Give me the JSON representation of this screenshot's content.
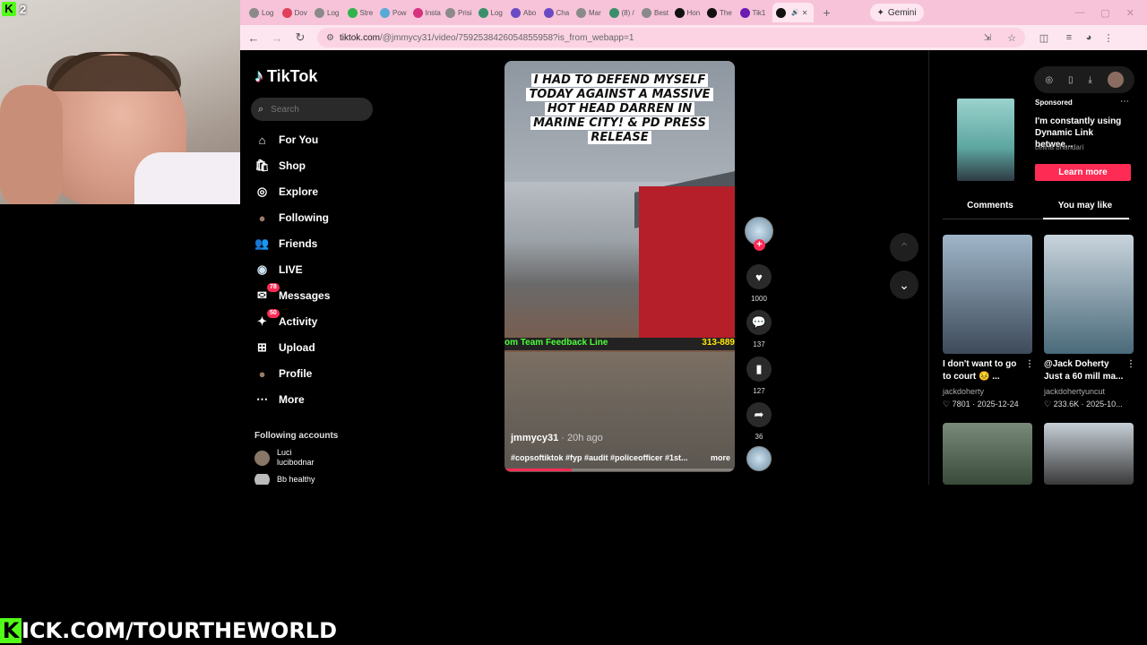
{
  "webcam": {
    "badge_count": "2"
  },
  "browser": {
    "tabs": [
      {
        "label": "Log",
        "color": "#8a8a8a"
      },
      {
        "label": "Dov",
        "color": "#e0405a"
      },
      {
        "label": "Log",
        "color": "#8a8a8a"
      },
      {
        "label": "Stre",
        "color": "#2fb34a"
      },
      {
        "label": "Pow",
        "color": "#59a9d8"
      },
      {
        "label": "Insta",
        "color": "#d6337c"
      },
      {
        "label": "Prisi",
        "color": "#8a8a8a"
      },
      {
        "label": "Log",
        "color": "#3a8f6a"
      },
      {
        "label": "Abo",
        "color": "#6a4bc4"
      },
      {
        "label": "Cha",
        "color": "#6a4bc4"
      },
      {
        "label": "Mar",
        "color": "#8a8a8a"
      },
      {
        "label": "(8) /",
        "color": "#3a8f6a"
      },
      {
        "label": "Best",
        "color": "#8a8a8a"
      },
      {
        "label": "Hon",
        "color": "#111111"
      },
      {
        "label": "The",
        "color": "#111111"
      },
      {
        "label": "Tik1",
        "color": "#6a1bb4"
      },
      {
        "label": "",
        "color": "#111111",
        "active": true
      }
    ],
    "new_tab": "+",
    "gemini": "Gemini",
    "window_controls": [
      "—",
      "▢",
      "✕"
    ],
    "url_domain": "tiktok.com",
    "url_path": "/@jmmycy31/video/7592538426054855958?is_from_webapp=1"
  },
  "tiktok": {
    "logo": "TikTok",
    "search_placeholder": "Search",
    "nav": [
      {
        "label": "For You",
        "icon": "home-icon",
        "glyph": "⌂"
      },
      {
        "label": "Shop",
        "icon": "shop-icon",
        "glyph": "🛍"
      },
      {
        "label": "Explore",
        "icon": "compass-icon",
        "glyph": "◎"
      },
      {
        "label": "Following",
        "icon": "following-avatar-icon",
        "glyph": "●"
      },
      {
        "label": "Friends",
        "icon": "friends-icon",
        "glyph": "👥"
      },
      {
        "label": "LIVE",
        "icon": "live-icon",
        "glyph": "◉"
      },
      {
        "label": "Messages",
        "icon": "messages-icon",
        "glyph": "✉",
        "badge": "78"
      },
      {
        "label": "Activity",
        "icon": "activity-icon",
        "glyph": "✦",
        "badge": "50"
      },
      {
        "label": "Upload",
        "icon": "upload-icon",
        "glyph": "⊞"
      },
      {
        "label": "Profile",
        "icon": "profile-icon",
        "glyph": "●"
      },
      {
        "label": "More",
        "icon": "more-icon",
        "glyph": "⋯"
      }
    ],
    "following_accounts_title": "Following accounts",
    "following_accounts": [
      {
        "name": "Luci",
        "handle": "lucibodnar"
      },
      {
        "name": "Bb healthy",
        "handle": ""
      }
    ],
    "video": {
      "caption_lines": [
        "I HAD TO DEFEND MYSELF",
        "TODAY AGAINST A MASSIVE",
        "HOT HEAD DARREN IN",
        "MARINE CITY! & PD PRESS",
        "RELEASE"
      ],
      "ticker_left": "om Team Feedback Line",
      "ticker_right": "313-889",
      "author": "jmmycy31",
      "time": "· 20h ago",
      "tags": "#copsoftiktok #fyp #audit #policeofficer #1st...",
      "more": "more",
      "progress": 0.29
    },
    "actions": {
      "likes": "1000",
      "comments": "137",
      "saves": "127",
      "shares": "36"
    },
    "right_panel": {
      "sponsored_label": "Sponsored",
      "ad_title": "I'm constantly using Dynamic Link betwee...",
      "ad_author": "celina bhandari",
      "ad_cta": "Learn more",
      "tabs": [
        "Comments",
        "You may like"
      ],
      "suggestions": [
        {
          "title": "I don't want to go to court 😣 ...",
          "author": "jackdoherty",
          "meta": "♡ 7801 · 2025-12-24",
          "colors": [
            "#9fb6c8",
            "#3d4a5a"
          ]
        },
        {
          "title": "@Jack Doherty Just a 60 mill ma...",
          "author": "jackdohertyuncut",
          "meta": "♡ 233.6K · 2025-10...",
          "colors": [
            "#c9d4dc",
            "#4a6a7a"
          ]
        },
        {
          "title": "",
          "author": "",
          "meta": "",
          "colors": [
            "#7a8a7a",
            "#3a4a3a"
          ]
        },
        {
          "title": "",
          "author": "",
          "meta": "",
          "colors": [
            "#c6cfd6",
            "#3a3a3a"
          ]
        }
      ]
    }
  },
  "stream_banner": {
    "text": "ICK.COM/TOURTHEWORLD",
    "k": "K"
  }
}
